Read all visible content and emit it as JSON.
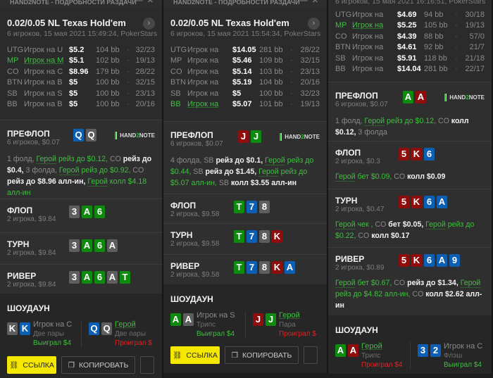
{
  "panels": [
    {
      "window_title": "HAND2NOTE - ПОДРОБНОСТИ РАЗДАЧИ",
      "title": "0.02/0.05 NL Texas Hold'em",
      "subtitle": "6 игроков, 15 мая 2021 15:49:24, PokerStars",
      "players": [
        {
          "pos": "UTG",
          "name": "Игрок на U",
          "stack": "$5.2",
          "bb": "104 bb",
          "vpip_pfr": "32/23",
          "hero": false
        },
        {
          "pos": "MP",
          "name": "Игрок на M",
          "stack": "$5.1",
          "bb": "102 bb",
          "vpip_pfr": "19/13",
          "hero": true
        },
        {
          "pos": "CO",
          "name": "Игрок на C",
          "stack": "$8.96",
          "bb": "179 bb",
          "vpip_pfr": "28/22",
          "hero": false
        },
        {
          "pos": "BTN",
          "name": "Игрок на B",
          "stack": "$5",
          "bb": "100 bb",
          "vpip_pfr": "32/15",
          "hero": false
        },
        {
          "pos": "SB",
          "name": "Игрок на S",
          "stack": "$5",
          "bb": "100 bb",
          "vpip_pfr": "23/13",
          "hero": false
        },
        {
          "pos": "BB",
          "name": "Игрок на B",
          "stack": "$5",
          "bb": "100 bb",
          "vpip_pfr": "20/16",
          "hero": false
        }
      ],
      "streets": [
        {
          "name": "ПРЕФЛОП",
          "info": "6 игроков, $0.07",
          "logo": "HAND2NOTE",
          "cards": [
            {
              "r": "Q",
              "c": "blue"
            },
            {
              "r": "Q",
              "c": "gray"
            }
          ],
          "actions": [
            [
              "n",
              "1 фолд, "
            ],
            [
              "h",
              "Герой"
            ],
            [
              "g",
              " рейз до $0.12, "
            ],
            [
              "n",
              "CO "
            ],
            [
              "w",
              "рейз до $0.4, "
            ],
            [
              "n",
              "3 фолда, "
            ],
            [
              "h",
              "Герой"
            ],
            [
              "g",
              " рейз до $0.92, "
            ],
            [
              "n",
              "CO "
            ],
            [
              "w",
              "рейз до $8.96 алл-ин, "
            ],
            [
              "h",
              "Герой"
            ],
            [
              "g",
              " колл $4.18 алл-ин"
            ]
          ]
        },
        {
          "name": "ФЛОП",
          "info": "2 игрока, $9.84",
          "cards": [
            {
              "r": "3",
              "c": "gray"
            },
            {
              "r": "A",
              "c": "green"
            },
            {
              "r": "6",
              "c": "green"
            }
          ],
          "actions": []
        },
        {
          "name": "ТУРН",
          "info": "2 игрока, $9.84",
          "cards": [
            {
              "r": "3",
              "c": "gray"
            },
            {
              "r": "A",
              "c": "green"
            },
            {
              "r": "6",
              "c": "green"
            },
            {
              "r": "A",
              "c": "gray"
            }
          ],
          "actions": []
        },
        {
          "name": "РИВЕР",
          "info": "2 игрока, $9.84",
          "cards": [
            {
              "r": "3",
              "c": "gray"
            },
            {
              "r": "A",
              "c": "green"
            },
            {
              "r": "6",
              "c": "green"
            },
            {
              "r": "A",
              "c": "gray"
            },
            {
              "r": "T",
              "c": "green"
            }
          ],
          "actions": []
        }
      ],
      "showdown": {
        "title": "ШОУДАУН",
        "left": {
          "cards": [
            {
              "r": "K",
              "c": "gray"
            },
            {
              "r": "K",
              "c": "blue"
            }
          ],
          "name": "Игрок на C",
          "hero": false,
          "hand": "Две пары",
          "result": "Выиграл $4",
          "win": true
        },
        "right": {
          "cards": [
            {
              "r": "Q",
              "c": "blue"
            },
            {
              "r": "Q",
              "c": "gray"
            }
          ],
          "name": "Герой",
          "hero": true,
          "hand": "Две пары",
          "result": "Проиграл $",
          "win": false
        }
      },
      "buttons": {
        "link": "ССЫЛКА",
        "copy": "КОПИРОВАТЬ"
      }
    },
    {
      "window_title": "HAND2NOTE - ПОДРОБНОСТИ РАЗДАЧИ",
      "title": "0.02/0.05 NL Texas Hold'em",
      "subtitle": "6 игроков, 15 мая 2021 15:54:34, PokerStars",
      "players": [
        {
          "pos": "UTG",
          "name": "Игрок на",
          "stack": "$14.05",
          "bb": "281 bb",
          "vpip_pfr": "28/22",
          "hero": false
        },
        {
          "pos": "MP",
          "name": "Игрок на",
          "stack": "$5.46",
          "bb": "109 bb",
          "vpip_pfr": "32/15",
          "hero": false
        },
        {
          "pos": "CO",
          "name": "Игрок на",
          "stack": "$5.14",
          "bb": "103 bb",
          "vpip_pfr": "23/13",
          "hero": false
        },
        {
          "pos": "BTN",
          "name": "Игрок на",
          "stack": "$5.19",
          "bb": "104 bb",
          "vpip_pfr": "20/16",
          "hero": false
        },
        {
          "pos": "SB",
          "name": "Игрок на",
          "stack": "$5",
          "bb": "100 bb",
          "vpip_pfr": "32/23",
          "hero": false
        },
        {
          "pos": "BB",
          "name": "Игрок на",
          "stack": "$5.07",
          "bb": "101 bb",
          "vpip_pfr": "19/13",
          "hero": true
        }
      ],
      "streets": [
        {
          "name": "ПРЕФЛОП",
          "info": "6 игроков, $0.07",
          "logo": "HAND2NOTE",
          "cards": [
            {
              "r": "J",
              "c": "red"
            },
            {
              "r": "J",
              "c": "green"
            }
          ],
          "actions": [
            [
              "n",
              "4 фолда, "
            ],
            [
              "n",
              "SB "
            ],
            [
              "w",
              "рейз до $0.1, "
            ],
            [
              "h",
              "Герой"
            ],
            [
              "g",
              " рейз до $0.44, "
            ],
            [
              "n",
              "SB "
            ],
            [
              "w",
              "рейз до $1.45, "
            ],
            [
              "h",
              "Герой"
            ],
            [
              "g",
              " рейз до $5.07 алл-ин, "
            ],
            [
              "n",
              "SB "
            ],
            [
              "w",
              "колл $3.55 алл-ин"
            ]
          ]
        },
        {
          "name": "ФЛОП",
          "info": "2 игрока, $9.58",
          "cards": [
            {
              "r": "T",
              "c": "green"
            },
            {
              "r": "7",
              "c": "blue"
            },
            {
              "r": "8",
              "c": "gray"
            }
          ],
          "actions": []
        },
        {
          "name": "ТУРН",
          "info": "2 игрока, $9.58",
          "cards": [
            {
              "r": "T",
              "c": "green"
            },
            {
              "r": "7",
              "c": "blue"
            },
            {
              "r": "8",
              "c": "gray"
            },
            {
              "r": "K",
              "c": "red"
            }
          ],
          "actions": []
        },
        {
          "name": "РИВЕР",
          "info": "2 игрока, $9.58",
          "cards": [
            {
              "r": "T",
              "c": "green"
            },
            {
              "r": "7",
              "c": "blue"
            },
            {
              "r": "8",
              "c": "gray"
            },
            {
              "r": "K",
              "c": "red"
            },
            {
              "r": "A",
              "c": "blue"
            }
          ],
          "actions": []
        }
      ],
      "showdown": {
        "title": "ШОУДАУН",
        "left": {
          "cards": [
            {
              "r": "A",
              "c": "green"
            },
            {
              "r": "A",
              "c": "gray"
            }
          ],
          "name": "Игрок на S",
          "hero": false,
          "hand": "Трипс",
          "result": "Выиграл $4",
          "win": true
        },
        "right": {
          "cards": [
            {
              "r": "J",
              "c": "red"
            },
            {
              "r": "J",
              "c": "green"
            }
          ],
          "name": "Герой",
          "hero": true,
          "hand": "Пара",
          "result": "Проиграл $",
          "win": false
        }
      },
      "buttons": {
        "link": "ССЫЛКА",
        "copy": "КОПИРОВАТЬ"
      }
    },
    {
      "subtitle": "6 игроков, 15 мая 2021 16:16:51, PokerStars",
      "players": [
        {
          "pos": "UTG",
          "name": "Игрок на",
          "stack": "$4.69",
          "bb": "94 bb",
          "vpip_pfr": "30/18",
          "hero": false
        },
        {
          "pos": "MP",
          "name": "Игрок на",
          "stack": "$5.25",
          "bb": "105 bb",
          "vpip_pfr": "19/13",
          "hero": true
        },
        {
          "pos": "CO",
          "name": "Игрок на",
          "stack": "$4.39",
          "bb": "88 bb",
          "vpip_pfr": "57/0",
          "hero": false
        },
        {
          "pos": "BTN",
          "name": "Игрок на",
          "stack": "$4.61",
          "bb": "92 bb",
          "vpip_pfr": "21/7",
          "hero": false
        },
        {
          "pos": "SB",
          "name": "Игрок на",
          "stack": "$5.91",
          "bb": "118 bb",
          "vpip_pfr": "21/18",
          "hero": false
        },
        {
          "pos": "BB",
          "name": "Игрок на",
          "stack": "$14.04",
          "bb": "281 bb",
          "vpip_pfr": "22/17",
          "hero": false
        }
      ],
      "streets": [
        {
          "name": "ПРЕФЛОП",
          "info": "6 игроков, $0.07",
          "logo": "HAND2NOTE",
          "cards": [
            {
              "r": "A",
              "c": "green"
            },
            {
              "r": "A",
              "c": "red"
            }
          ],
          "actions": [
            [
              "n",
              "1 фолд, "
            ],
            [
              "h",
              "Герой"
            ],
            [
              "g",
              " рейз до $0.12, "
            ],
            [
              "n",
              "CO "
            ],
            [
              "w",
              "колл $0.12, "
            ],
            [
              "n",
              "3 фолда"
            ]
          ]
        },
        {
          "name": "ФЛОП",
          "info": "2 игрока, $0.3",
          "cards": [
            {
              "r": "5",
              "c": "red"
            },
            {
              "r": "K",
              "c": "red"
            },
            {
              "r": "6",
              "c": "blue"
            }
          ],
          "actions": [
            [
              "h",
              "Герой"
            ],
            [
              "g",
              " бет $0.09, "
            ],
            [
              "n",
              "CO "
            ],
            [
              "w",
              "колл $0.09"
            ]
          ]
        },
        {
          "name": "ТУРН",
          "info": "2 игрока, $0.47",
          "cards": [
            {
              "r": "5",
              "c": "red"
            },
            {
              "r": "K",
              "c": "red"
            },
            {
              "r": "6",
              "c": "blue"
            },
            {
              "r": "A",
              "c": "blue"
            }
          ],
          "actions": [
            [
              "h",
              "Герой"
            ],
            [
              "g",
              " чек , "
            ],
            [
              "n",
              "CO "
            ],
            [
              "w",
              "бет $0.05, "
            ],
            [
              "h",
              "Герой"
            ],
            [
              "g",
              " рейз до $0.22, "
            ],
            [
              "n",
              "CO "
            ],
            [
              "w",
              "колл $0.17"
            ]
          ]
        },
        {
          "name": "РИВЕР",
          "info": "2 игрока, $0.89",
          "cards": [
            {
              "r": "5",
              "c": "red"
            },
            {
              "r": "K",
              "c": "red"
            },
            {
              "r": "6",
              "c": "blue"
            },
            {
              "r": "A",
              "c": "blue"
            },
            {
              "r": "9",
              "c": "blue"
            }
          ],
          "actions": [
            [
              "h",
              "Герой"
            ],
            [
              "g",
              " бет $0.67, "
            ],
            [
              "n",
              "CO "
            ],
            [
              "w",
              "рейз до $1.34, "
            ],
            [
              "h",
              "Герой"
            ],
            [
              "g",
              " рейз до $4.82 алл-ин, "
            ],
            [
              "n",
              "CO "
            ],
            [
              "w",
              "колл $2.62 алл-ин"
            ]
          ]
        }
      ],
      "showdown": {
        "title": "ШОУДАУН",
        "left": {
          "cards": [
            {
              "r": "A",
              "c": "green"
            },
            {
              "r": "A",
              "c": "red"
            }
          ],
          "name": "Герой",
          "hero": true,
          "hand": "Трипс",
          "result": "Проиграл $4",
          "win": false
        },
        "right": {
          "cards": [
            {
              "r": "3",
              "c": "blue"
            },
            {
              "r": "2",
              "c": "blue"
            }
          ],
          "name": "Игрок на C",
          "hero": false,
          "hand": "Флэш",
          "result": "Выиграл $4",
          "win": true
        }
      }
    }
  ],
  "colors": {
    "card_blue": "#0c5fb3",
    "card_green": "#0e8b0e",
    "card_red": "#8e0d0d",
    "card_gray": "#5e5e5e",
    "hero": "#3fbf3f",
    "lose": "#e82020",
    "link_button": "#f5e800"
  }
}
